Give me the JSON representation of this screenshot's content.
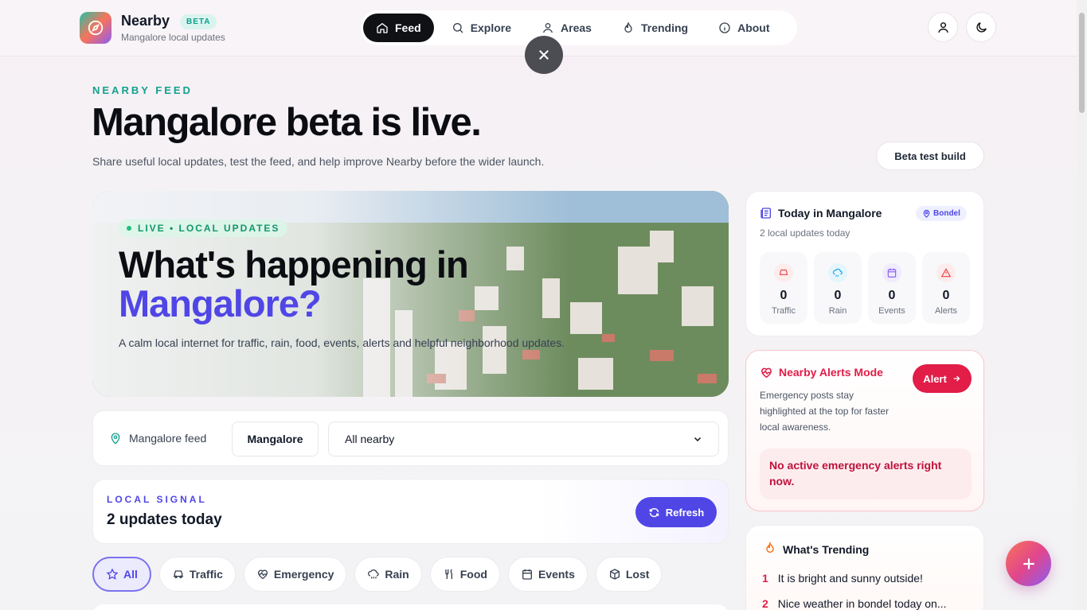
{
  "app": {
    "name": "Nearby",
    "badge": "BETA",
    "subtitle": "Mangalore local updates"
  },
  "nav": {
    "items": [
      {
        "label": "Feed",
        "icon": "home-icon",
        "active": true
      },
      {
        "label": "Explore",
        "icon": "search-icon"
      },
      {
        "label": "Areas",
        "icon": "user-pin-icon"
      },
      {
        "label": "Trending",
        "icon": "flame-icon"
      },
      {
        "label": "About",
        "icon": "info-icon"
      }
    ]
  },
  "header": {
    "profile_icon": "user-icon",
    "theme_icon": "moon-icon",
    "close_icon": "close-icon"
  },
  "page": {
    "eyebrow": "NEARBY FEED",
    "title": "Mangalore beta is live.",
    "subtitle": "Share useful local updates, test the feed, and help improve Nearby before the wider launch.",
    "beta_button": "Beta test build"
  },
  "hero": {
    "pill": "LIVE • LOCAL UPDATES",
    "title_line1": "What's happening in",
    "title_line2": "Mangalore?",
    "description": "A calm local internet for traffic, rain, food, events, alerts and helpful neighborhood updates."
  },
  "location": {
    "label": "Mangalore feed",
    "city": "Mangalore",
    "filter": "All nearby"
  },
  "signal": {
    "eyebrow": "LOCAL SIGNAL",
    "title": "2 updates today",
    "refresh": "Refresh"
  },
  "chips": [
    {
      "label": "All",
      "icon": "star-icon",
      "active": true
    },
    {
      "label": "Traffic",
      "icon": "car-icon"
    },
    {
      "label": "Emergency",
      "icon": "heart-pulse-icon"
    },
    {
      "label": "Rain",
      "icon": "cloud-rain-icon"
    },
    {
      "label": "Food",
      "icon": "utensils-icon"
    },
    {
      "label": "Events",
      "icon": "calendar-icon"
    },
    {
      "label": "Lost",
      "icon": "box-icon"
    }
  ],
  "today": {
    "title": "Today in Mangalore",
    "area": "Bondel",
    "subtitle": "2 local updates today",
    "stats": [
      {
        "label": "Traffic",
        "value": "0",
        "color": "#ef4444"
      },
      {
        "label": "Rain",
        "value": "0",
        "color": "#0ea5e9"
      },
      {
        "label": "Events",
        "value": "0",
        "color": "#8b5cf6"
      },
      {
        "label": "Alerts",
        "value": "0",
        "color": "#ef4444"
      }
    ]
  },
  "alerts": {
    "title": "Nearby Alerts Mode",
    "button": "Alert",
    "description": "Emergency posts stay highlighted at the top for faster local awareness.",
    "status": "No active emergency alerts right now."
  },
  "trending": {
    "title": "What's Trending",
    "items": [
      {
        "rank": "1",
        "text": "It is bright and sunny outside!"
      },
      {
        "rank": "2",
        "text": "Nice weather in bondel today on..."
      }
    ]
  },
  "colors": {
    "accent": "#5046e6",
    "alert": "#e11d48",
    "teal": "#14a08f"
  }
}
